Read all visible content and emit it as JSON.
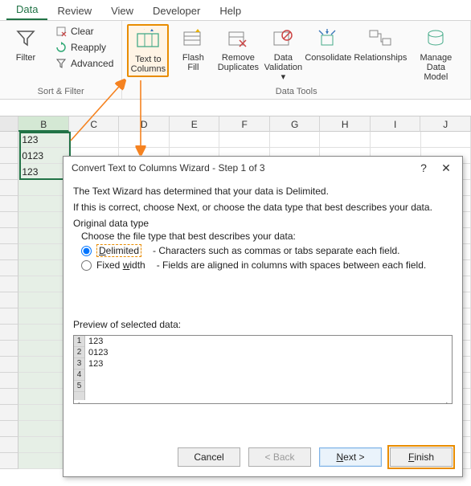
{
  "tabs": {
    "data": "Data",
    "review": "Review",
    "view": "View",
    "developer": "Developer",
    "help": "Help"
  },
  "ribbon": {
    "filter": "Filter",
    "clear": "Clear",
    "reapply": "Reapply",
    "advanced": "Advanced",
    "sort_filter": "Sort & Filter",
    "text_to_columns_l1": "Text to",
    "text_to_columns_l2": "Columns",
    "flash_fill_l1": "Flash",
    "flash_fill_l2": "Fill",
    "remove_dup_l1": "Remove",
    "remove_dup_l2": "Duplicates",
    "data_val_l1": "Data",
    "data_val_l2": "Validation",
    "consolidate": "Consolidate",
    "relationships": "Relationships",
    "manage_dm_l1": "Manage",
    "manage_dm_l2": "Data Model",
    "data_tools": "Data Tools"
  },
  "columns": [
    "B",
    "C",
    "D",
    "E",
    "F",
    "G",
    "H",
    "I",
    "J"
  ],
  "cells": {
    "b1": "123",
    "b2": "0123",
    "b3": " 123"
  },
  "dialog": {
    "title": "Convert Text to Columns Wizard - Step 1 of 3",
    "p1": "The Text Wizard has determined that your data is Delimited.",
    "p2": "If this is correct, choose Next, or choose the data type that best describes your data.",
    "origlabel": "Original data type",
    "choose": "Choose the file type that best describes your data:",
    "delimited": "Delimited",
    "delimited_desc": "- Characters such as commas or tabs separate each field.",
    "fixed": "Fixed width",
    "fixed_desc": "- Fields are aligned in columns with spaces between each field.",
    "preview_label": "Preview of selected data:",
    "preview_rows": [
      "1",
      "2",
      "3",
      "4",
      "5"
    ],
    "preview_text": [
      "123",
      "0123",
      " 123"
    ],
    "cancel": "Cancel",
    "back": "< Back",
    "next": "Next >",
    "finish": "Finish"
  }
}
